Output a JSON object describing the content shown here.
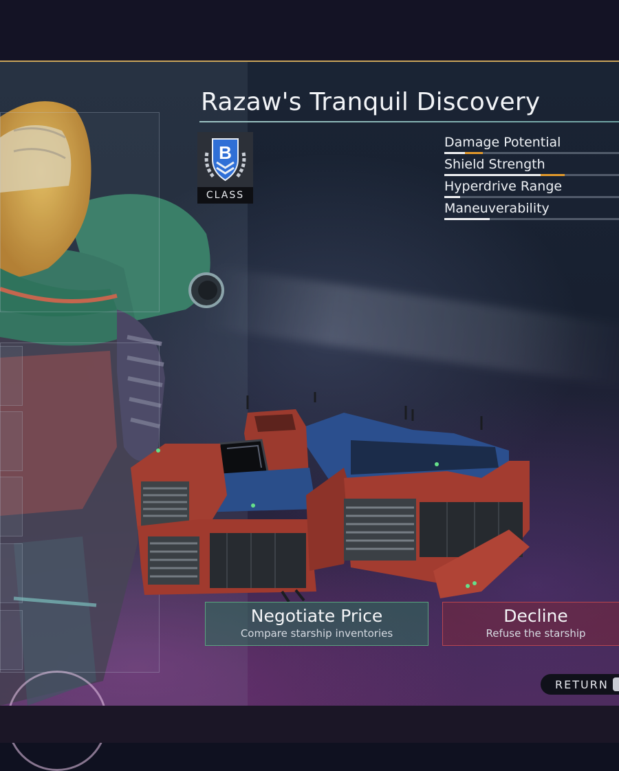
{
  "ship": {
    "name": "Razaw's Tranquil Discovery",
    "class_letter": "B",
    "class_label": "CLASS",
    "class_color": "#2f6fd6"
  },
  "stats": [
    {
      "label": "Damage Potential",
      "value": 0.12,
      "bonus": 0.1
    },
    {
      "label": "Shield Strength",
      "value": 0.55,
      "bonus": 0.14
    },
    {
      "label": "Hyperdrive Range",
      "value": 0.09,
      "bonus": 0.0
    },
    {
      "label": "Maneuverability",
      "value": 0.26,
      "bonus": 0.0
    }
  ],
  "actions": {
    "negotiate": {
      "title": "Negotiate Price",
      "subtitle": "Compare starship inventories"
    },
    "decline": {
      "title": "Decline",
      "subtitle": "Refuse the starship"
    }
  },
  "return_label": "RETURN",
  "colors": {
    "accent_gold": "#c8a45a",
    "stat_bonus": "#e39a2c",
    "negotiate_border": "#5aa37f",
    "decline_border": "#b8454f"
  }
}
